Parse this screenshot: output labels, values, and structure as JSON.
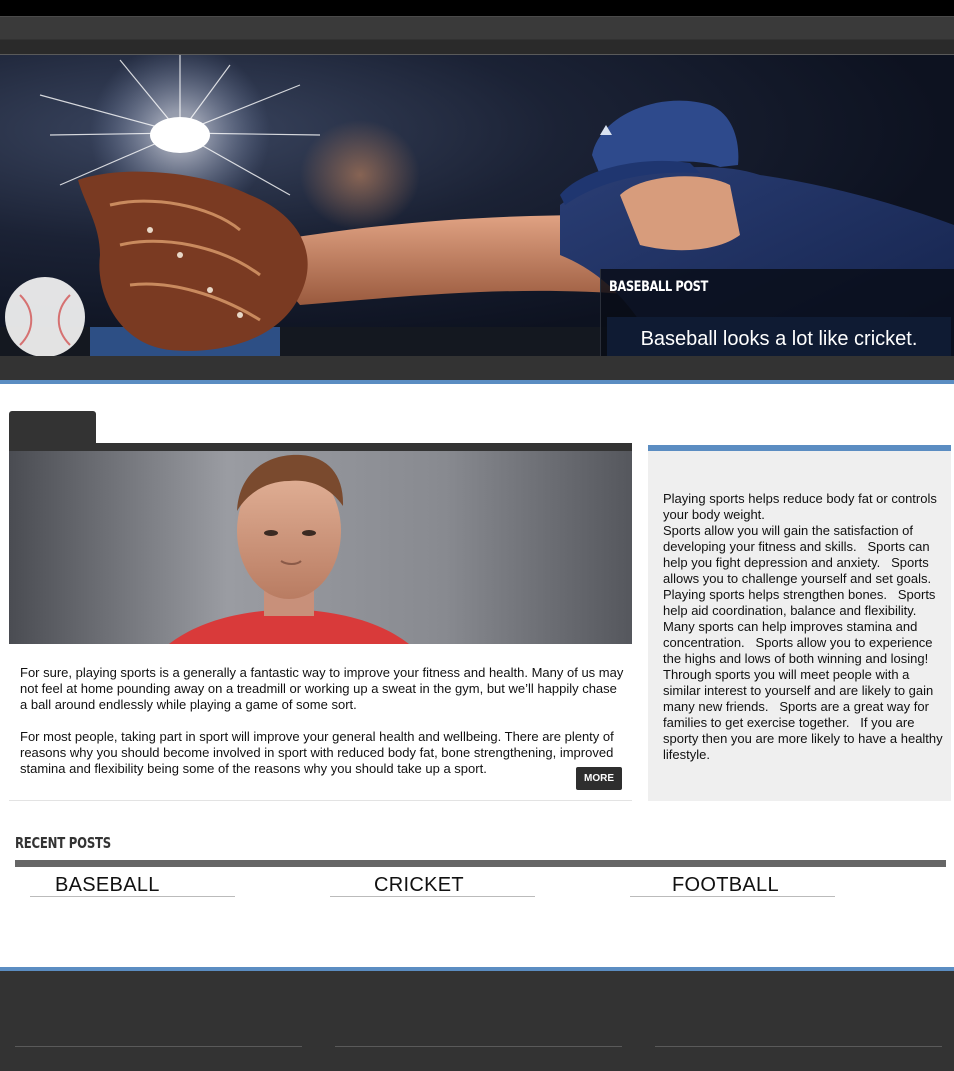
{
  "hero": {
    "caption_label": "BASEBALL POST",
    "caption_title": "Baseball looks a lot like cricket."
  },
  "article": {
    "paragraph_1": "For sure, playing sports is a generally a fantastic way to improve your fitness and health. Many of us may not feel at home pounding away on a treadmill or working up a sweat in the gym, but we’ll happily chase a ball around endlessly while playing a game of some sort.",
    "paragraph_2": "For most people, taking part in sport will improve your general health and wellbeing. There are plenty of reasons why you should become involved in sport with reduced body fat, bone strengthening, improved stamina and flexibility being some of the reasons why you should take up a sport.",
    "more_label": "MORE"
  },
  "sidebar": {
    "text": "Playing sports helps reduce body fat or controls your body weight.\nSports allow you will gain the satisfaction of developing your fitness and skills.   Sports can help you fight depression and anxiety.   Sports allows you to challenge yourself and set goals.   Playing sports helps strengthen bones.   Sports help aid coordination, balance and flexibility.   Many sports can help improves stamina and concentration.   Sports allow you to experience the highs and lows of both winning and losing!   Through sports you will meet people with a similar interest to yourself and are likely to gain many new friends.   Sports are a great way for families to get exercise together.   If you are sporty then you are more likely to have a healthy lifestyle."
  },
  "recent_posts": {
    "heading": "RECENT POSTS",
    "items": [
      {
        "label": "BASEBALL"
      },
      {
        "label": "CRICKET"
      },
      {
        "label": "FOOTBALL"
      }
    ]
  },
  "colors": {
    "accent_blue": "#5b8dc2",
    "dark_gray": "#333333",
    "sidebar_bg": "#efefef"
  }
}
